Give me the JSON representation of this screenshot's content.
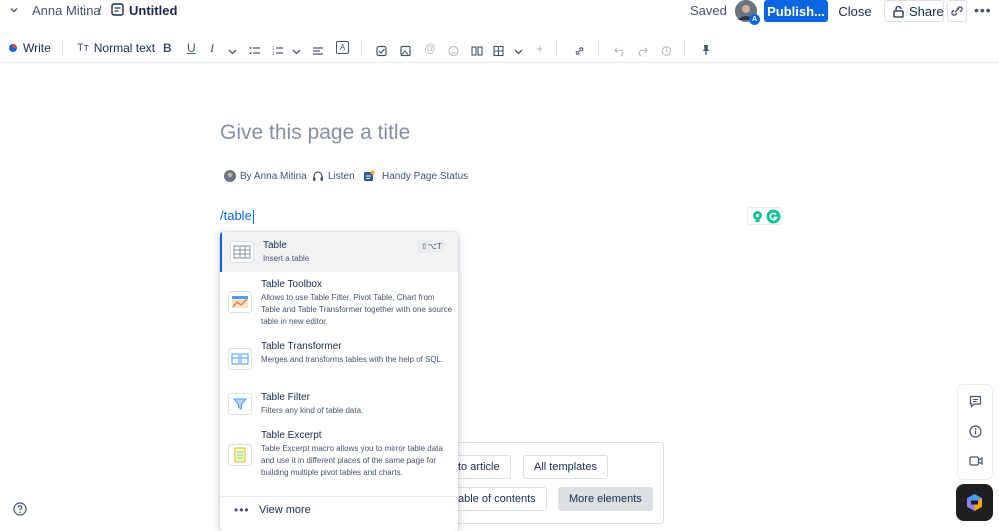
{
  "header": {
    "breadcrumb_user": "Anna Mitina",
    "breadcrumb_separator": "/",
    "page_title": "Untitled",
    "saved_label": "Saved",
    "avatar_badge": "A",
    "publish_label": "Publish...",
    "close_label": "Close",
    "share_label": "Share"
  },
  "toolbar": {
    "write_label": "Write",
    "text_style_label": "Normal text"
  },
  "editor": {
    "title_placeholder": "Give this page a title",
    "byline": "By Anna Mitina",
    "listen_label": "Listen",
    "status_label": "Handy Page Status",
    "slash_text": "/table"
  },
  "menu": {
    "items": [
      {
        "title": "Table",
        "description": "Insert a table",
        "shortcut": "⇧⌥T",
        "icon": "table-icon"
      },
      {
        "title": "Table Toolbox",
        "description": "Allows to use Table Filter, Pivot Table, Chart from Table and Table Transformer together with one source table in new editor.",
        "icon": "table-toolbox-icon"
      },
      {
        "title": "Table Transformer",
        "description": "Merges and transforms tables with the help of SQL.",
        "icon": "table-transformer-icon"
      },
      {
        "title": "Table Filter",
        "description": "Filters any kind of table data.",
        "icon": "table-filter-icon"
      },
      {
        "title": "Table Excerpt",
        "description": "Table Excerpt macro allows you to mirror table data and use it in different places of the same page for building multiple pivot tables and charts.",
        "icon": "table-excerpt-icon"
      }
    ],
    "view_more": "View more"
  },
  "templates": {
    "to_article": "to article",
    "all_templates": "All templates",
    "table_of_contents": "able of contents",
    "more_elements": "More elements"
  },
  "colors": {
    "accent": "#0c66e4",
    "text": "#172b4d",
    "subtle": "#44546f",
    "placeholder": "#8590a2"
  }
}
